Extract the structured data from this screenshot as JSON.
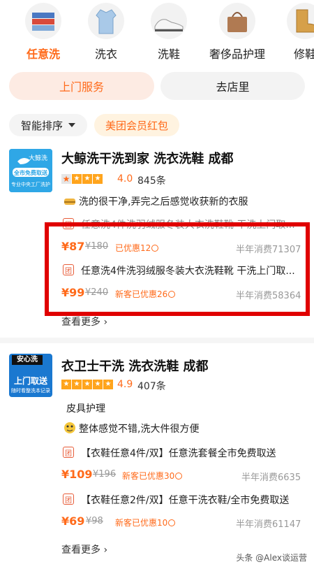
{
  "categories": [
    {
      "label": "任意洗",
      "icon": "shirts-stack-icon",
      "active": true
    },
    {
      "label": "洗衣",
      "icon": "shirt-icon",
      "active": false
    },
    {
      "label": "洗鞋",
      "icon": "sneaker-icon",
      "active": false
    },
    {
      "label": "奢侈品护理",
      "icon": "handbag-icon",
      "active": false
    },
    {
      "label": "修鞋",
      "icon": "boot-icon",
      "active": false
    }
  ],
  "service_tabs": {
    "door": "上门服务",
    "store": "去店里"
  },
  "filters": {
    "sort": "智能排序",
    "coupon": "美团会员红包"
  },
  "colors": {
    "accent": "#ff6a1a",
    "highlight_box": "#e00000"
  },
  "shops": [
    {
      "name": "大鲸洗干洗到家 洗衣洗鞋 成都",
      "logo": {
        "brand": "大鲸洗",
        "line1": "全市免费取送",
        "line2": "专业中央工厂洗护"
      },
      "stars": 4,
      "rating": "4.0",
      "reviews": "845条",
      "review_snippet": "洗的很干净,弄完之后感觉收获新的衣服",
      "deals": [
        {
          "badge": "团",
          "title": "任意洗4件洗羽绒服冬装大衣洗鞋靴 干洗上门取...",
          "price": "¥87",
          "original": "¥180",
          "discount": "已优惠12",
          "sales": "半年消费71307"
        },
        {
          "badge": "团",
          "title": "任意洗4件洗羽绒服冬装大衣洗鞋靴 干洗上门取...",
          "price": "¥99",
          "original": "¥240",
          "discount": "新客已优惠26",
          "sales": "半年消费58364"
        }
      ],
      "more": "查看更多"
    },
    {
      "name": "衣卫士干洗 洗衣洗鞋 成都",
      "logo": {
        "brand": "安心洗",
        "line1": "上门取送",
        "line2": "随时看整洗本记录"
      },
      "stars": 5,
      "rating": "4.9",
      "reviews": "407条",
      "tag": "皮具护理",
      "review_snippet": "整体感觉不错,洗大件很方便",
      "deals": [
        {
          "badge": "团",
          "title": "【衣鞋任意4件/双】任意洗套餐全市免费取送",
          "price": "¥109",
          "original": "¥196",
          "discount": "新客已优惠30",
          "sales": "半年消费6635"
        },
        {
          "badge": "团",
          "title": "【衣鞋任意2件/双】任意干洗衣鞋/全市免费取送",
          "price": "¥69",
          "original": "¥98",
          "discount": "新客已优惠10",
          "sales": "半年消费61147"
        }
      ],
      "more": "查看更多"
    }
  ],
  "watermark": "头条 @Alex谈运营"
}
